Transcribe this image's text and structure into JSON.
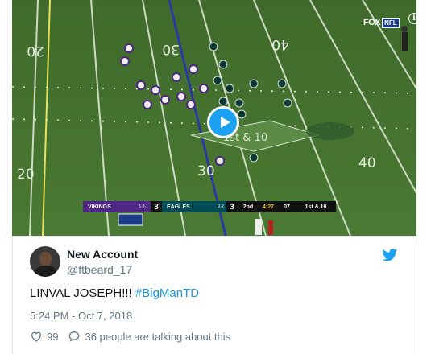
{
  "media": {
    "broadcaster": "FOX",
    "network": "NFL",
    "yard_numbers": [
      "20",
      "30",
      "40",
      "40",
      "30",
      "20"
    ],
    "field_logo_text": "1st & 10",
    "scorebug": {
      "away_team": "VIKINGS",
      "away_record": "1-2-1",
      "away_score": "3",
      "home_team": "EAGLES",
      "home_record": "2-2",
      "home_score": "3",
      "quarter": "2nd",
      "clock": "4:27",
      "play_clock": "07",
      "down_distance": "1st & 10"
    },
    "info_glyph": "i"
  },
  "tweet": {
    "display_name": "New Account",
    "handle": "@ftbeard_17",
    "text_plain": "LINVAL JOSEPH!!! ",
    "hashtag": "#BigManTD",
    "timestamp": "5:24 PM - Oct 7, 2018",
    "likes": "99",
    "talking": "36 people are talking about this"
  },
  "colors": {
    "twitter_blue": "#1da1f2",
    "hashtag_blue": "#1b95e0",
    "vikings_purple": "#4f2683",
    "eagles_green": "#004c54"
  }
}
